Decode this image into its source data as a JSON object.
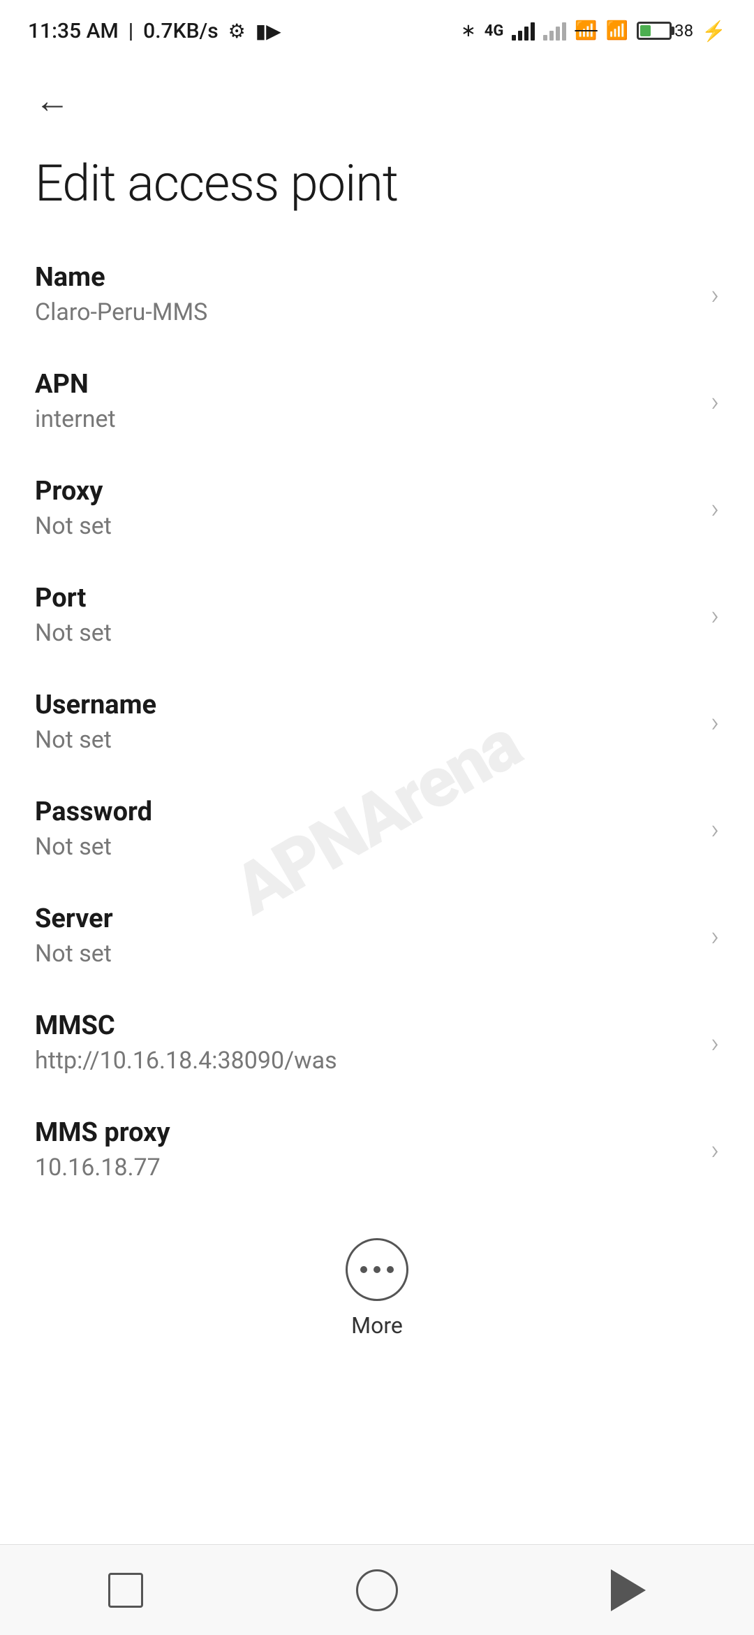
{
  "statusBar": {
    "time": "11:35 AM",
    "networkSpeed": "0.7KB/s",
    "batteryPercent": "38"
  },
  "navigation": {
    "backLabel": "←"
  },
  "page": {
    "title": "Edit access point"
  },
  "settings": [
    {
      "id": "name",
      "title": "Name",
      "value": "Claro-Peru-MMS"
    },
    {
      "id": "apn",
      "title": "APN",
      "value": "internet"
    },
    {
      "id": "proxy",
      "title": "Proxy",
      "value": "Not set"
    },
    {
      "id": "port",
      "title": "Port",
      "value": "Not set"
    },
    {
      "id": "username",
      "title": "Username",
      "value": "Not set"
    },
    {
      "id": "password",
      "title": "Password",
      "value": "Not set"
    },
    {
      "id": "server",
      "title": "Server",
      "value": "Not set"
    },
    {
      "id": "mmsc",
      "title": "MMSC",
      "value": "http://10.16.18.4:38090/was"
    },
    {
      "id": "mms-proxy",
      "title": "MMS proxy",
      "value": "10.16.18.77"
    }
  ],
  "more": {
    "label": "More"
  },
  "watermark": {
    "text": "APNArena"
  },
  "bottomNav": {
    "recents": "recents",
    "home": "home",
    "back": "back"
  }
}
